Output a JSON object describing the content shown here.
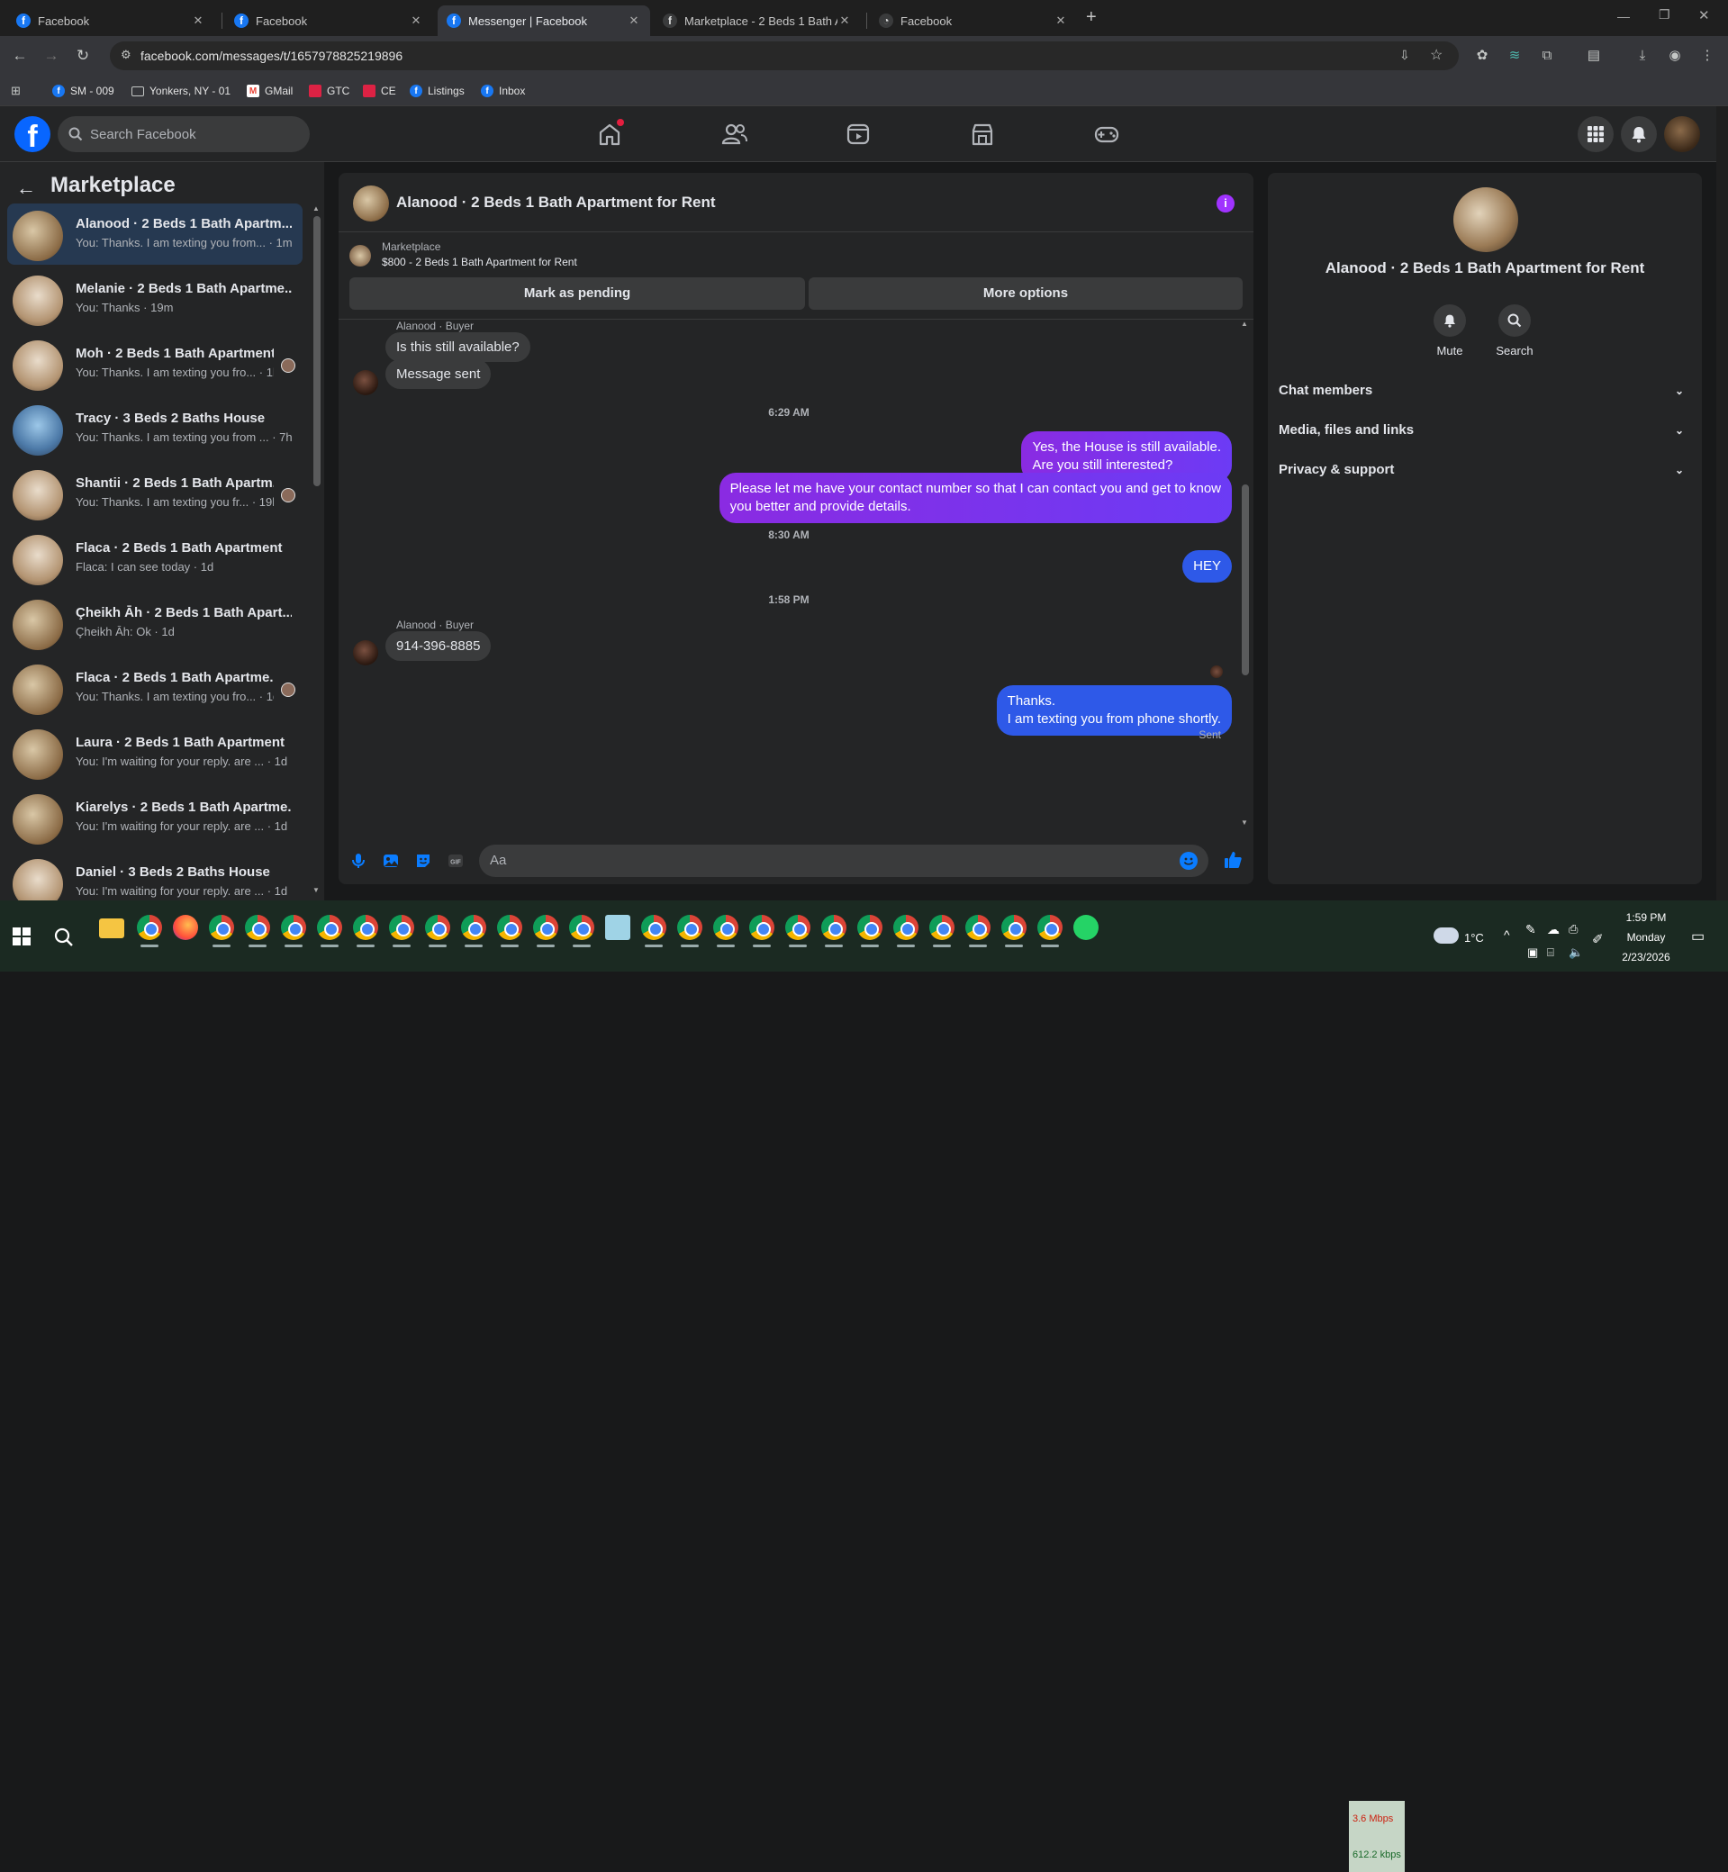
{
  "browser": {
    "tabs": [
      {
        "title": "Facebook"
      },
      {
        "title": "Facebook"
      },
      {
        "title": "Messenger | Facebook"
      },
      {
        "title": "Marketplace - 2 Beds 1 Bath Ap"
      },
      {
        "title": "Facebook"
      }
    ],
    "url": "facebook.com/messages/t/1657978825219896",
    "bookmarks": [
      {
        "label": "SM - 009",
        "icon": "facebook-icon"
      },
      {
        "label": "Yonkers, NY - 01",
        "icon": "folder-icon"
      },
      {
        "label": "GMail",
        "icon": "gmail-icon"
      },
      {
        "label": "GTC",
        "icon": "image-icon"
      },
      {
        "label": "CE",
        "icon": "image-icon"
      },
      {
        "label": "Listings",
        "icon": "facebook-icon"
      },
      {
        "label": "Inbox",
        "icon": "facebook-icon"
      }
    ]
  },
  "fb": {
    "search_placeholder": "Search Facebook",
    "nav_icons": [
      "home-icon",
      "friends-icon",
      "video-icon",
      "marketplace-icon",
      "gaming-icon"
    ]
  },
  "sidebar": {
    "title": "Marketplace",
    "chats": [
      {
        "name": "Alanood · 2 Beds 1 Bath Apartm...",
        "preview": "You: Thanks. I am texting you from... · 1m",
        "selected": true
      },
      {
        "name": "Melanie · 2 Beds 1 Bath Apartme...",
        "preview": "You: Thanks · 19m"
      },
      {
        "name": "Moh · 2 Beds 1 Bath Apartment",
        "preview": "You: Thanks. I am texting you fro... · 1h"
      },
      {
        "name": "Tracy · 3 Beds 2 Baths House",
        "preview": "You: Thanks. I am texting you from ... · 7h"
      },
      {
        "name": "Shantii · 2 Beds 1 Bath Apartm...",
        "preview": "You: Thanks. I am texting you fr... · 19h"
      },
      {
        "name": "Flaca · 2 Beds 1 Bath Apartment",
        "preview": "Flaca: I can see today · 1d"
      },
      {
        "name": "Çheikh Āh · 2 Beds 1 Bath Apart...",
        "preview": "Çheikh Āh: Ok · 1d"
      },
      {
        "name": "Flaca · 2 Beds 1 Bath Apartme...",
        "preview": "You: Thanks. I am texting you fro... · 1d"
      },
      {
        "name": "Laura · 2 Beds 1 Bath Apartment",
        "preview": "You: I'm waiting for your reply. are ... · 1d"
      },
      {
        "name": "Kiarelys · 2 Beds 1 Bath Apartme...",
        "preview": "You: I'm waiting for your reply. are ... · 1d"
      },
      {
        "name": "Daniel · 3 Beds 2 Baths House",
        "preview": "You: I'm waiting for your reply. are ... · 1d"
      }
    ]
  },
  "conversation": {
    "title": "Alanood · 2 Beds 1 Bath Apartment for Rent",
    "source": "Marketplace",
    "listing": "$800 - 2 Beds 1 Bath Apartment for Rent",
    "mark_pending": "Mark as pending",
    "more_options": "More options",
    "sender_label": "Alanood · Buyer",
    "messages": {
      "m1": "Is this still available?",
      "m2": "Message sent",
      "t1": "6:29 AM",
      "m3": "Yes, the House is still available.\nAre you still interested?",
      "m4": "Please let me have your contact number so that I can contact you and get to know\nyou better and provide details.",
      "t2": "8:30 AM",
      "m5": "HEY",
      "t3": "1:58 PM",
      "m6": "914-396-8885",
      "m7": "Thanks.\nI am texting you from phone shortly."
    },
    "sent_label": "Sent",
    "input_placeholder": "Aa"
  },
  "details": {
    "title": "Alanood · 2 Beds 1 Bath Apartment for Rent",
    "mute": "Mute",
    "search": "Search",
    "sections": [
      "Chat members",
      "Media, files and links",
      "Privacy & support"
    ]
  },
  "taskbar": {
    "net_down": "3.6 Mbps",
    "net_up": "612.2 kbps",
    "temp": "1°C",
    "time": "1:59 PM",
    "day": "Monday",
    "date": "2/23/2026"
  },
  "colors": {
    "accent_purple": "#8a2be2",
    "accent_blue": "#2e59e8",
    "fb_blue": "#0866ff"
  }
}
